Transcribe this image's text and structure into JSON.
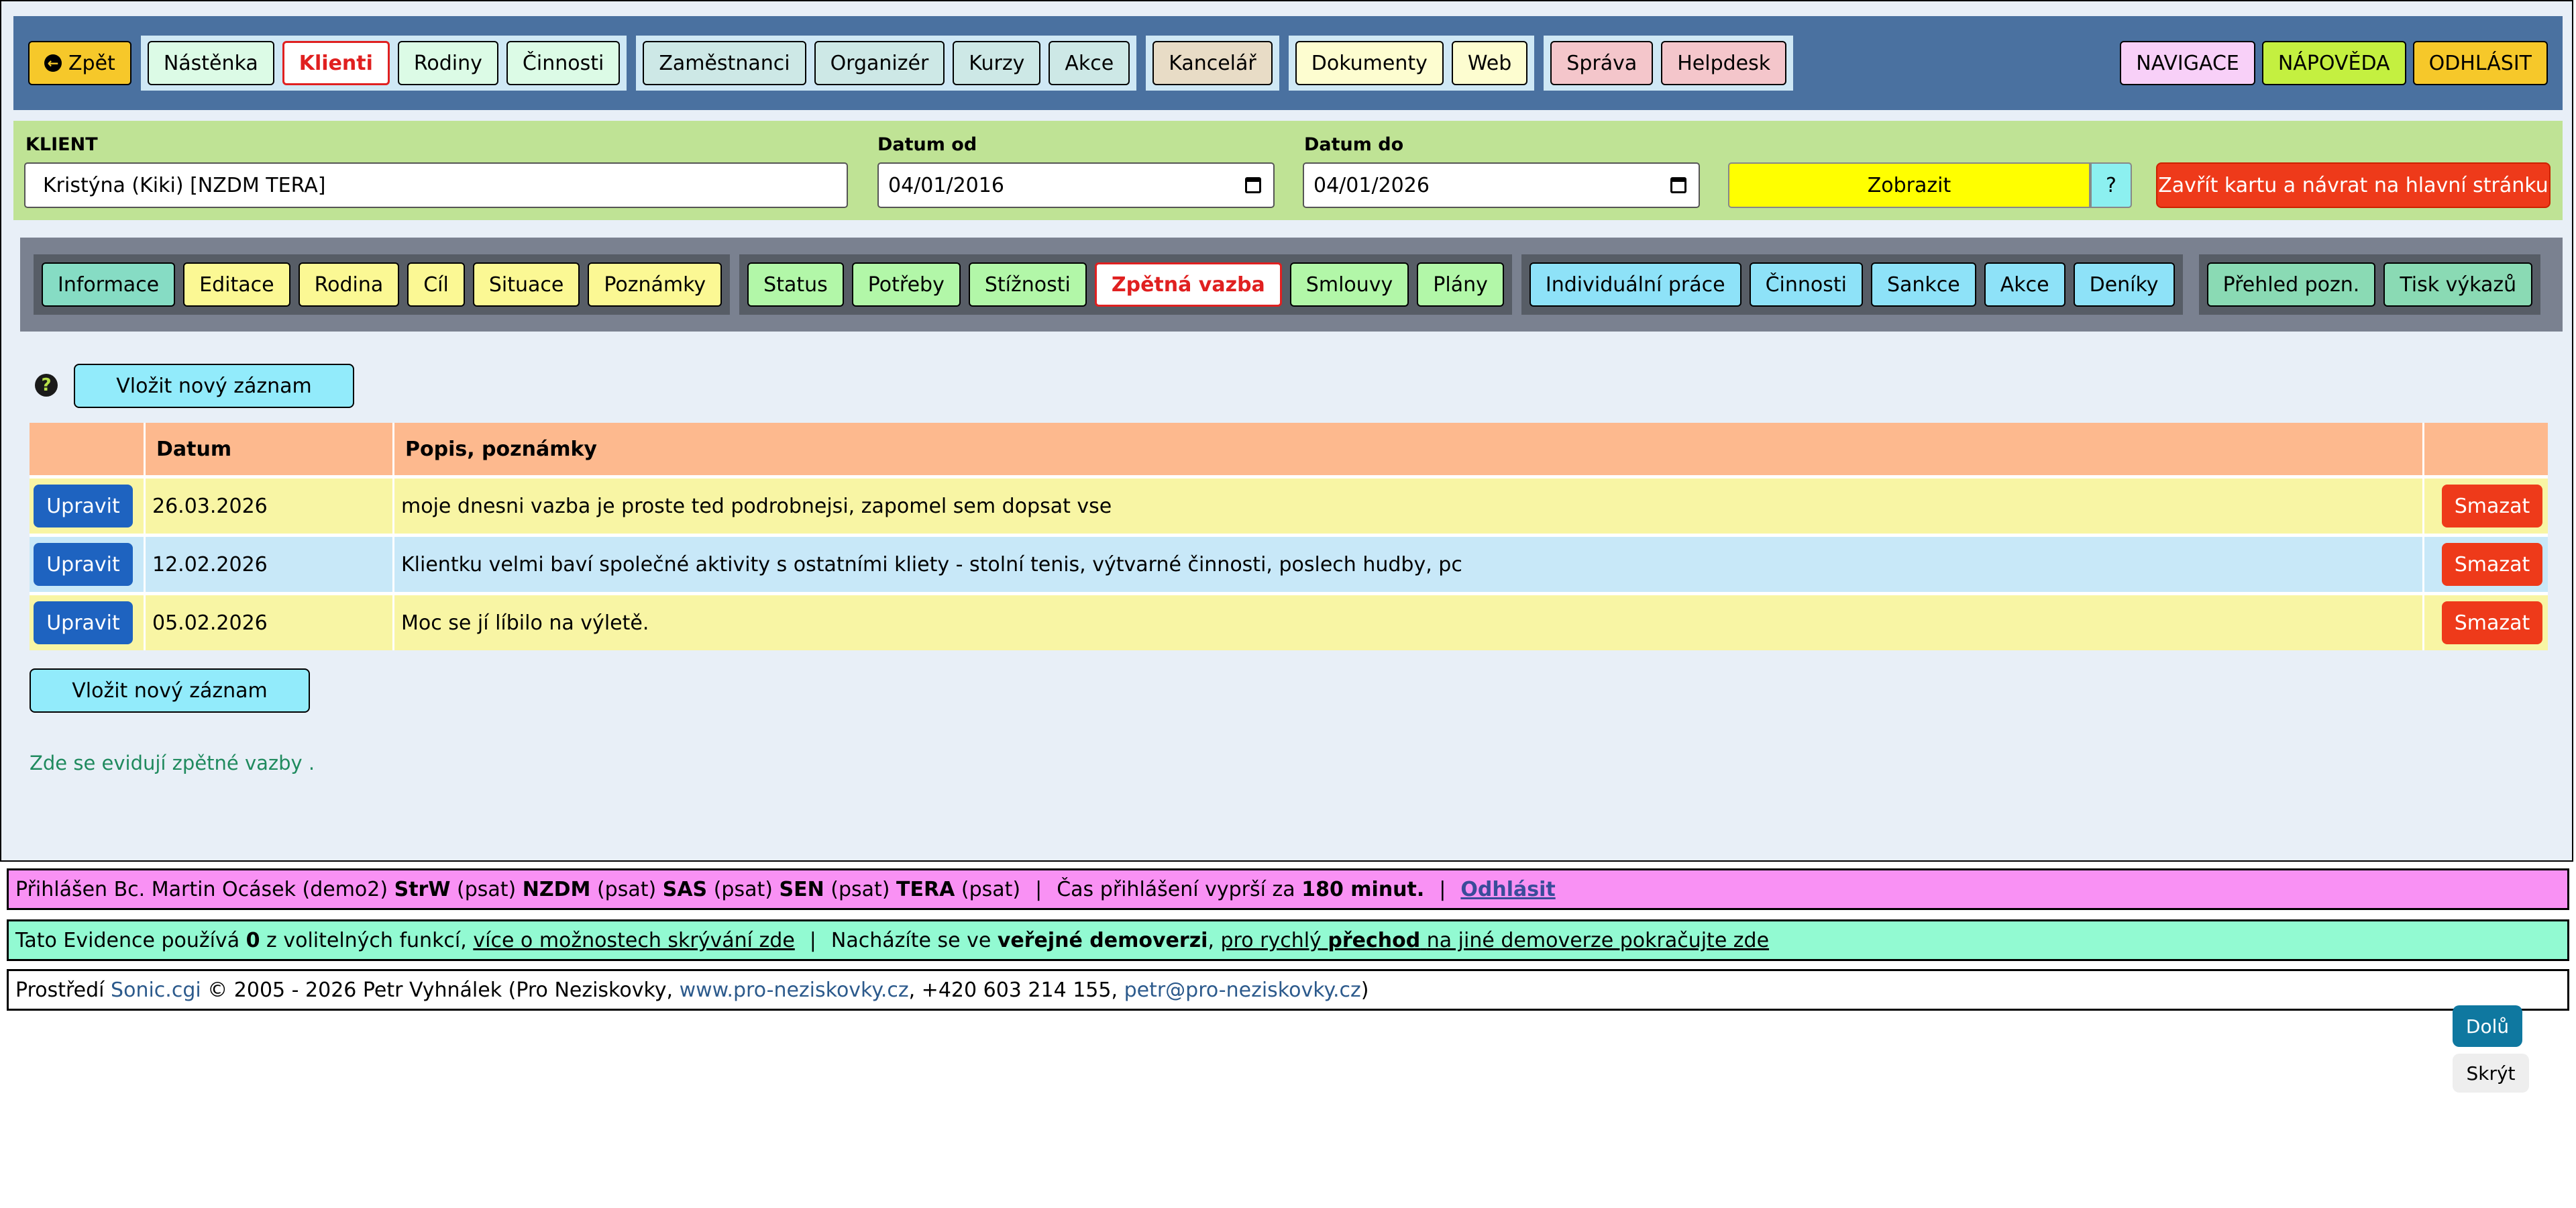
{
  "topnav": {
    "back": "Zpět",
    "items": [
      "Nástěnka",
      "Klienti",
      "Rodiny",
      "Činnosti"
    ],
    "group2": [
      "Zaměstnanci",
      "Organizér",
      "Kurzy",
      "Akce"
    ],
    "group3": [
      "Kancelář"
    ],
    "group4": [
      "Dokumenty",
      "Web"
    ],
    "group5": [
      "Správa",
      "Helpdesk"
    ],
    "active": "Klienti",
    "right": [
      "NAVIGACE",
      "NÁPOVĚDA",
      "ODHLÁSIT"
    ]
  },
  "filter": {
    "client_label": "KLIENT",
    "client_value": "Kristýna (Kiki) [NZDM TERA]",
    "date_from_label": "Datum od",
    "date_from_value": "04/01/2016",
    "date_to_label": "Datum do",
    "date_to_value": "04/01/2026",
    "show_button": "Zobrazit",
    "help_button": "?",
    "close_button": "Zavřít kartu a návrat na hlavní stránku"
  },
  "client_tabs": {
    "g1": [
      "Informace",
      "Editace",
      "Rodina",
      "Cíl",
      "Situace",
      "Poznámky"
    ],
    "g2": [
      "Status",
      "Potřeby",
      "Stížnosti",
      "Zpětná vazba",
      "Smlouvy",
      "Plány"
    ],
    "g3": [
      "Individuální práce",
      "Činnosti",
      "Sankce",
      "Akce",
      "Deníky"
    ],
    "g4": [
      "Přehled pozn.",
      "Tisk výkazů"
    ],
    "active": "Zpětná vazba"
  },
  "content": {
    "new_record": "Vložit nový záznam",
    "help_icon": "question-circle-icon",
    "columns": [
      "",
      "Datum",
      "Popis, poznámky",
      ""
    ],
    "edit_label": "Upravit",
    "delete_label": "Smazat",
    "rows": [
      {
        "date": "26.03.2026",
        "text": "moje dnesni vazba je proste ted podrobnejsi, zapomel sem dopsat vse"
      },
      {
        "date": "12.02.2026",
        "text": "Klientku velmi baví společné aktivity s ostatními kliety - stolní tenis, výtvarné činnosti, poslech hudby, pc"
      },
      {
        "date": "05.02.2026",
        "text": "Moc se jí líbilo na výletě."
      }
    ],
    "note": "Zde se evidují zpětné vazby ."
  },
  "footer": {
    "line1": {
      "prefix": "Přihlášen Bc. Martin Ocásek (demo2)",
      "s1": "StrW",
      "s1p": "(psat)",
      "s2": "NZDM",
      "s2p": "(psat)",
      "s3": "SAS",
      "s3p": "(psat)",
      "s4": "SEN",
      "s4p": "(psat)",
      "s5": "TERA",
      "s5p": "(psat)",
      "timeout_prefix": "Čas přihlášení vyprší za",
      "timeout_value": "180 minut.",
      "logout": "Odhlásit"
    },
    "line2": {
      "a": "Tato Evidence používá",
      "count": "0",
      "b": "z volitelných funkcí,",
      "link1": "více o možnostech skrývání zde",
      "c": "Nacházíte se ve",
      "bold1": "veřejné demoverzi",
      "link2a": "pro rychlý",
      "link2b": "přechod",
      "link2c": "na jiné demoverze pokračujte zde"
    },
    "line3": {
      "a": "Prostředí",
      "link1": "Sonic.cgi",
      "b": "© 2005 - 2026 Petr Vyhnálek (Pro Neziskovky,",
      "link2": "www.pro-neziskovky.cz",
      "c": ", +420 603 214 155,",
      "link3": "petr@pro-neziskovky.cz",
      "d": ")"
    }
  },
  "float": {
    "down": "Dolů",
    "hide": "Skrýt"
  }
}
